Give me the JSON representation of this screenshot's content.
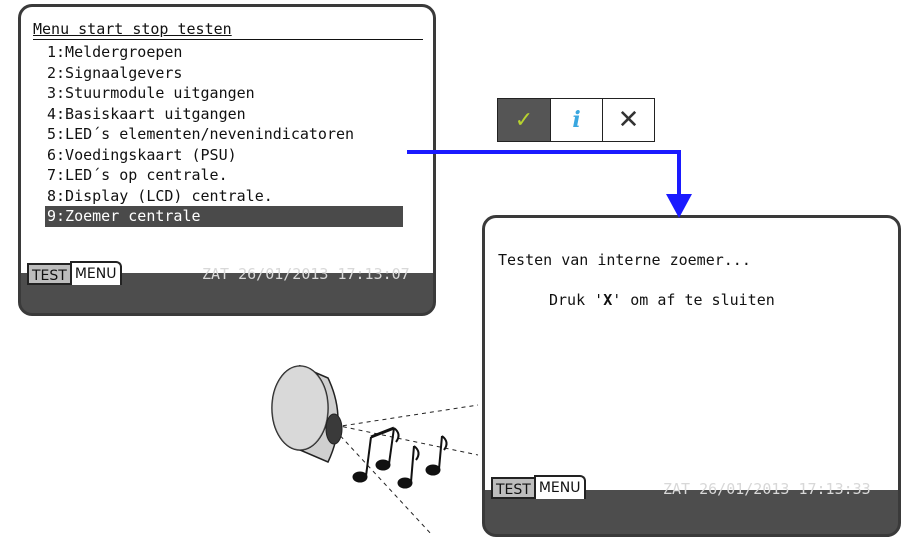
{
  "screen1": {
    "title": "Menu start stop testen",
    "items": [
      "1:Meldergroepen",
      "2:Signaalgevers",
      "3:Stuurmodule uitgangen",
      "4:Basiskaart uitgangen",
      "5:LED´s elementen/nevenindicatoren",
      "6:Voedingskaart (PSU)",
      "7:LED´s op centrale.",
      "8:Display (LCD) centrale.",
      "9:Zoemer centrale"
    ],
    "selected_index": 8,
    "tab_test": "TEST",
    "tab_menu": "MENU",
    "status": "ZAT 26/01/2013 17:13:07"
  },
  "keys": {
    "ok_icon": "checkmark-icon",
    "info_icon": "info-icon",
    "close_icon": "close-icon",
    "ok_color": "#b7d22f",
    "info_color": "#3aa7e0"
  },
  "screen2": {
    "line1": "Testen van interne zoemer...",
    "line2_before": "Druk '",
    "line2_key": "X",
    "line2_after": "' om af te sluiten",
    "tab_test": "TEST",
    "tab_menu": "MENU",
    "status": "ZAT 26/01/2013 17:13:33"
  },
  "colors": {
    "arrow": "#1a1aff",
    "panel": "#4d4d4d",
    "selection": "#4a4a4a"
  }
}
